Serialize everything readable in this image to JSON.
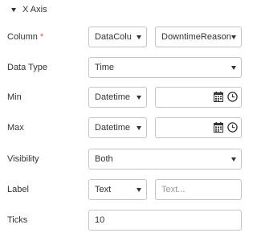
{
  "section": {
    "title": "X Axis"
  },
  "rows": {
    "column": {
      "label": "Column",
      "required_mark": "*",
      "source_value": "DataColu",
      "field_value": "DowntimeReason"
    },
    "data_type": {
      "label": "Data Type",
      "value": "Time"
    },
    "min": {
      "label": "Min",
      "type_value": "Datetime",
      "date_value": ""
    },
    "max": {
      "label": "Max",
      "type_value": "Datetime",
      "date_value": ""
    },
    "visibility": {
      "label": "Visibility",
      "value": "Both"
    },
    "axis_label": {
      "label": "Label",
      "type_value": "Text",
      "placeholder": "Text..."
    },
    "ticks": {
      "label": "Ticks",
      "value": "10"
    }
  },
  "icons": [
    "caret-down-icon",
    "calendar-icon",
    "clock-icon"
  ]
}
